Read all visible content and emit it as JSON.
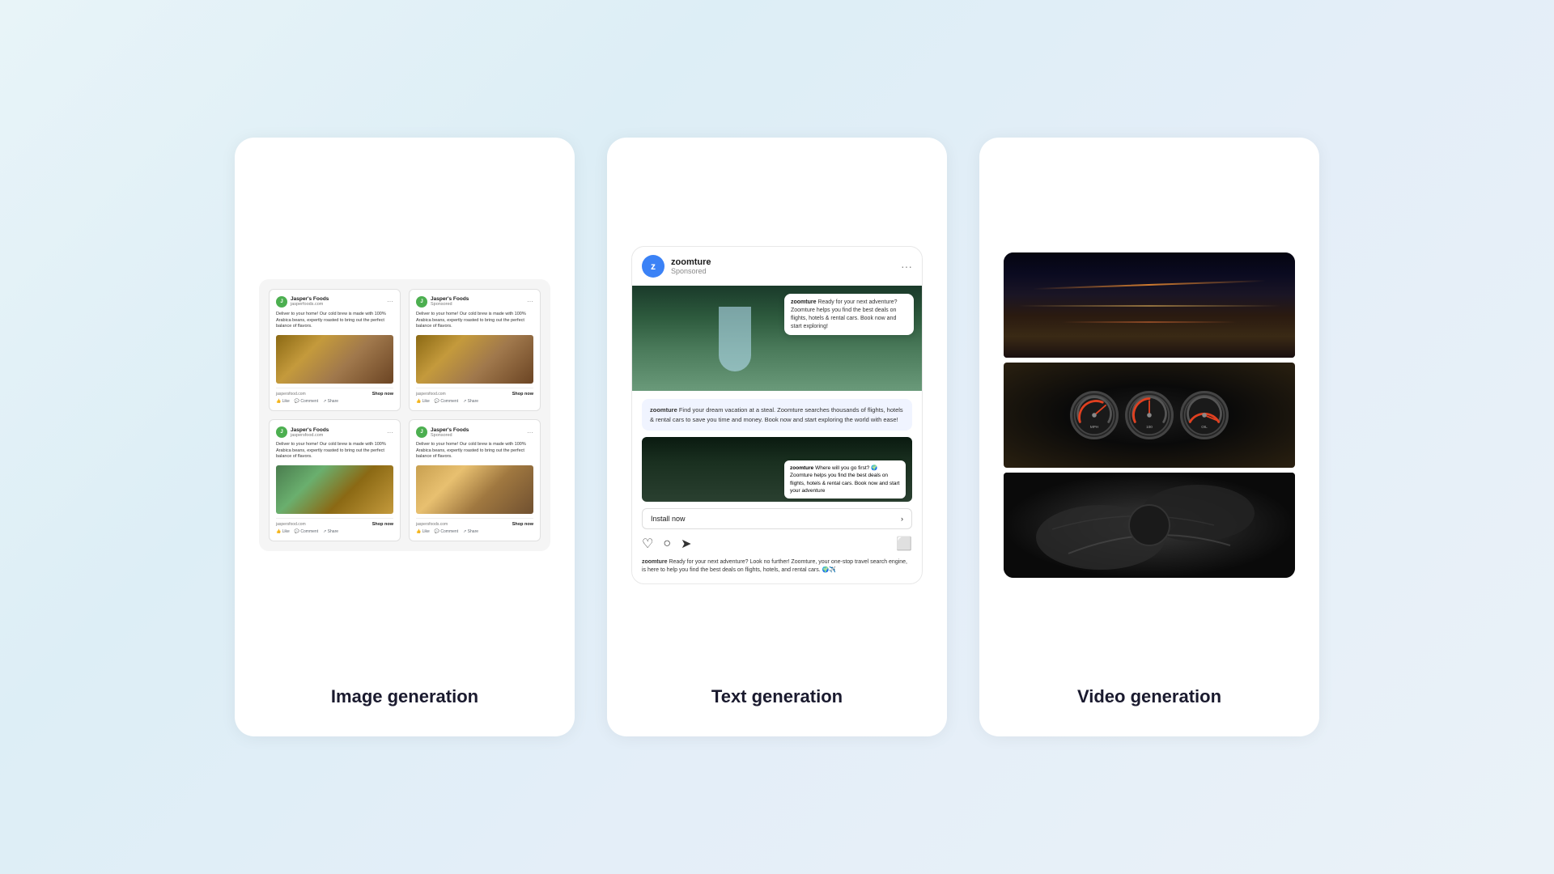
{
  "background": {
    "gradient": "linear-gradient(135deg, #e8f4f8, #ddeef6, #e4eef8)"
  },
  "cards": [
    {
      "id": "image-generation",
      "label": "Image generation",
      "posts": [
        {
          "company": "Jasper's Foods",
          "sub": "jasperfoods.com",
          "text": "Deliver to your home! Our cold brew is made with 100% Arabica beans, expertly roasted to bring out the perfect balance of flavors.",
          "imageType": "brown",
          "link": "jaspersfood.com",
          "cta": "Shop now"
        },
        {
          "company": "Jasper's Foods",
          "sub": "Sponsored",
          "text": "Deliver to your home! Our cold brew is made with 100% Arabica beans, expertly roasted to bring out the perfect balance of flavors.",
          "imageType": "brown",
          "link": "jaspersfood.com",
          "cta": "Shop now"
        },
        {
          "company": "Jasper's Foods",
          "sub": "jaspersfood.com",
          "text": "Deliver to your home! Our cold brew is made with 100% Arabica beans, expertly roasted to bring out the perfect balance of flavors.",
          "imageType": "green",
          "link": "jaspersfood.com",
          "cta": "Shop now"
        },
        {
          "company": "Jasper's Foods",
          "sub": "Sponsored",
          "text": "Deliver to your home! Our cold brew is made with 100% Arabica beans, expertly roasted to bring out the perfect balance of flavors.",
          "imageType": "green",
          "link": "jaspersfoods.com",
          "cta": "Shop now"
        }
      ]
    },
    {
      "id": "text-generation",
      "label": "Text generation",
      "ig": {
        "username": "zoomture",
        "avatar_letter": "z",
        "sponsored": "Sponsored",
        "caption1_bold": "zoomture",
        "caption1_text": "Ready for your next adventure? Zoomture helps you find the best deals on flights, hotels & rental cars. Book now and start exploring!",
        "desc_bold": "zoomture",
        "desc_text": "Find your dream vacation at a steal. Zoomture searches thousands of flights, hotels & rental cars to save you time and money. Book now and start exploring the world with ease!",
        "caption2_bold": "zoomture",
        "caption2_text": "Where will you go first? 🌍 Zoomture helps you find the best deals on flights, hotels & rental cars. Book now and start your adventure",
        "install_cta": "Install now",
        "long_caption_bold": "zoomture",
        "long_caption": "Ready for your next adventure? Look no further! Zoomture, your one-stop travel search engine, is here to help you find the best deals on flights, hotels, and rental cars. 🌍✈️"
      }
    },
    {
      "id": "video-generation",
      "label": "Video generation"
    }
  ]
}
